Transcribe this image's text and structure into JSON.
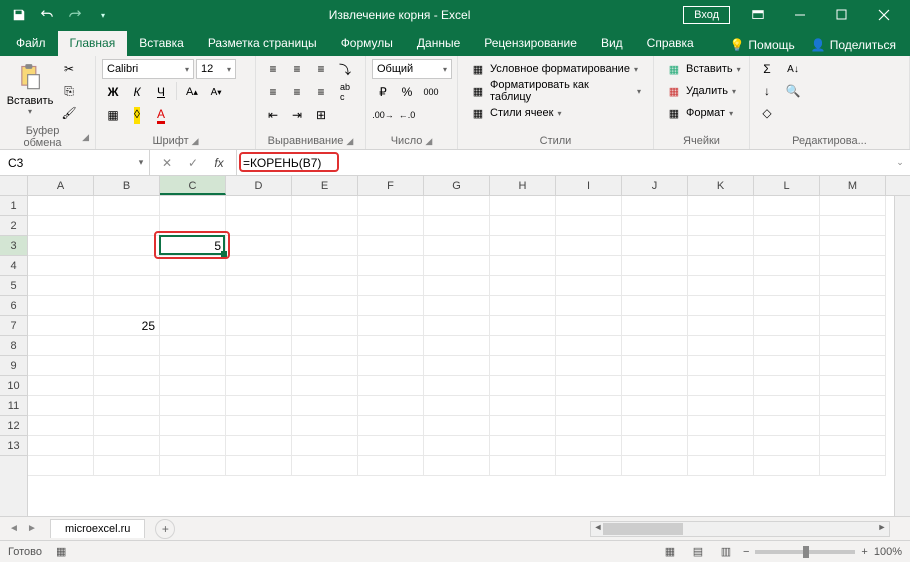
{
  "title": "Извлечение корня  -  Excel",
  "login": "Вход",
  "tabs": {
    "file": "Файл",
    "home": "Главная",
    "insert": "Вставка",
    "pagelayout": "Разметка страницы",
    "formulas": "Формулы",
    "data": "Данные",
    "review": "Рецензирование",
    "view": "Вид",
    "help": "Справка",
    "tellme": "Помощь",
    "share": "Поделиться"
  },
  "ribbon": {
    "clipboard": {
      "paste": "Вставить",
      "label": "Буфер обмена"
    },
    "font": {
      "name": "Calibri",
      "size": "12",
      "label": "Шрифт",
      "bold": "Ж",
      "italic": "К",
      "underline": "Ч"
    },
    "alignment": {
      "label": "Выравнивание"
    },
    "number": {
      "format": "Общий",
      "label": "Число"
    },
    "styles": {
      "cond": "Условное форматирование",
      "table": "Форматировать как таблицу",
      "cell": "Стили ячеек",
      "label": "Стили"
    },
    "cells": {
      "insert": "Вставить",
      "delete": "Удалить",
      "format": "Формат",
      "label": "Ячейки"
    },
    "editing": {
      "label": "Редактирова..."
    }
  },
  "formula_bar": {
    "cell_ref": "C3",
    "formula": "=КОРЕНЬ(B7)"
  },
  "columns": [
    "A",
    "B",
    "C",
    "D",
    "E",
    "F",
    "G",
    "H",
    "I",
    "J",
    "K",
    "L",
    "M"
  ],
  "rows": [
    "1",
    "2",
    "3",
    "4",
    "5",
    "6",
    "7",
    "8",
    "9",
    "10",
    "11",
    "12",
    "13"
  ],
  "cells": {
    "C3": "5",
    "B7": "25"
  },
  "sheet": {
    "name": "microexcel.ru"
  },
  "status": {
    "ready": "Готово",
    "zoom": "100%"
  }
}
